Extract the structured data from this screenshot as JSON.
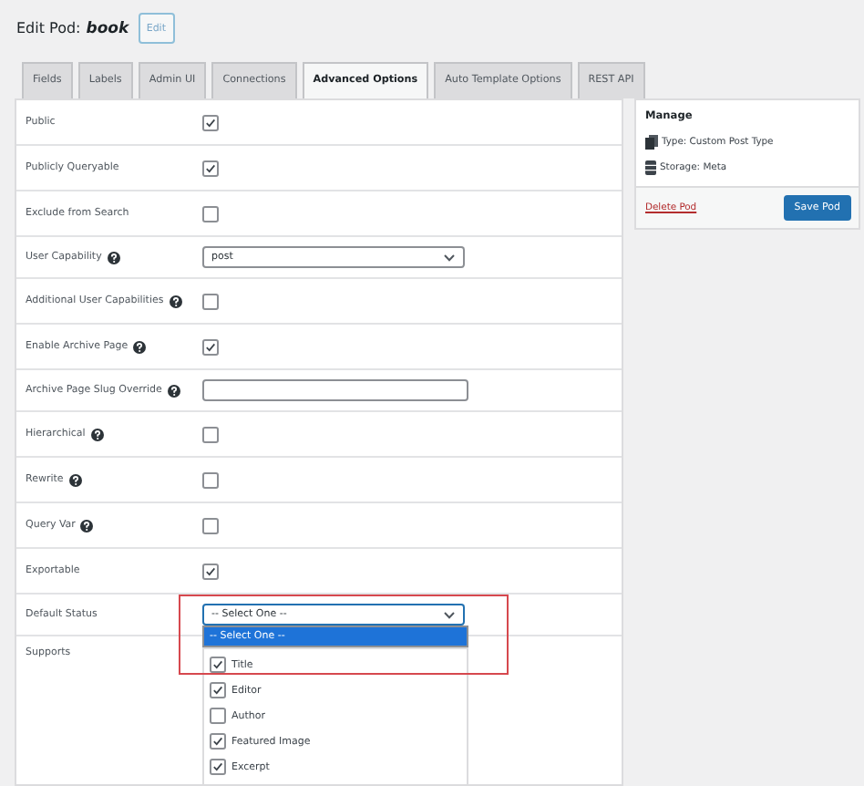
{
  "header": {
    "title": "Edit Pod:",
    "pod_name": "book",
    "edit_button": "Edit"
  },
  "tabs": [
    {
      "label": "Fields",
      "selected": false
    },
    {
      "label": "Labels",
      "selected": false
    },
    {
      "label": "Admin UI",
      "selected": false
    },
    {
      "label": "Connections",
      "selected": false
    },
    {
      "label": "Advanced Options",
      "selected": true
    },
    {
      "label": "Auto Template Options",
      "selected": false
    },
    {
      "label": "REST API",
      "selected": false
    }
  ],
  "options": [
    {
      "kind": "checkbox",
      "label": "Public",
      "help": false,
      "checked": true
    },
    {
      "kind": "checkbox",
      "label": "Publicly Queryable",
      "help": false,
      "checked": true
    },
    {
      "kind": "checkbox",
      "label": "Exclude from Search",
      "help": false,
      "checked": false
    },
    {
      "kind": "select",
      "label": "User Capability",
      "help": true,
      "value": "post",
      "open": false
    },
    {
      "kind": "checkbox",
      "label": "Additional User Capabilities",
      "help": true,
      "checked": false
    },
    {
      "kind": "checkbox",
      "label": "Enable Archive Page",
      "help": true,
      "checked": true
    },
    {
      "kind": "text",
      "label": "Archive Page Slug Override",
      "help": true
    },
    {
      "kind": "checkbox",
      "label": "Hierarchical",
      "help": true,
      "checked": false
    },
    {
      "kind": "checkbox",
      "label": "Rewrite",
      "help": true,
      "checked": false
    },
    {
      "kind": "checkbox",
      "label": "Query Var",
      "help": true,
      "checked": false
    },
    {
      "kind": "checkbox",
      "label": "Exportable",
      "help": false,
      "checked": true
    },
    {
      "kind": "select",
      "label": "Default Status",
      "help": false,
      "value": "-- Select One --",
      "open": true,
      "options": [
        {
          "label": "-- Select One --",
          "selected": true
        }
      ]
    },
    {
      "kind": "checklist",
      "label": "Supports",
      "help": false,
      "items": [
        {
          "label": "Title",
          "checked": true
        },
        {
          "label": "Editor",
          "checked": true
        },
        {
          "label": "Author",
          "checked": false
        },
        {
          "label": "Featured Image",
          "checked": true
        },
        {
          "label": "Excerpt",
          "checked": true
        }
      ]
    }
  ],
  "manage": {
    "title": "Manage",
    "type": "Type: Custom Post Type",
    "storage": "Storage: Meta",
    "delete_link": "Delete Pod",
    "save_button": "Save Pod"
  }
}
